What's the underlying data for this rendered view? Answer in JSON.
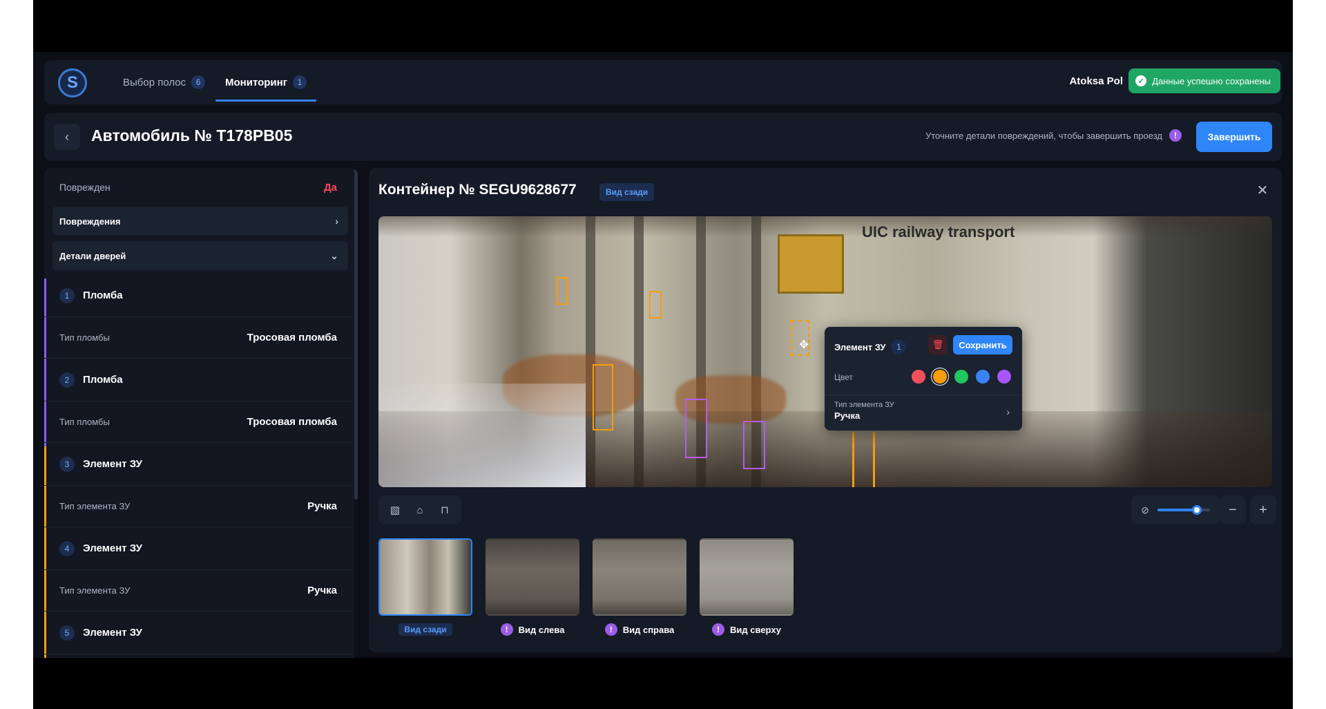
{
  "nav": {
    "tabs": [
      {
        "label": "Выбор полос",
        "count": "6"
      },
      {
        "label": "Мониторинг",
        "count": "1"
      }
    ],
    "user": "Atoksa Pol",
    "toast": "Данные успешно сохранены"
  },
  "header": {
    "title": "Автомобиль № Т178РВ05",
    "hint": "Уточните детали повреждений, чтобы завершить проезд",
    "hint_icon": "!",
    "finish": "Завершить"
  },
  "sidebar": {
    "damaged_label": "Поврежден",
    "damaged_value": "Да",
    "damages_label": "Повреждения",
    "door_details_label": "Детали дверей",
    "items": [
      {
        "num": "1",
        "title": "Пломба",
        "prop_label": "Тип пломбы",
        "prop_value": "Тросовая пломба"
      },
      {
        "num": "2",
        "title": "Пломба",
        "prop_label": "Тип пломбы",
        "prop_value": "Тросовая пломба"
      },
      {
        "num": "3",
        "title": "Элемент ЗУ",
        "prop_label": "Тип элемента ЗУ",
        "prop_value": "Ручка"
      },
      {
        "num": "4",
        "title": "Элемент ЗУ",
        "prop_label": "Тип элемента ЗУ",
        "prop_value": "Ручка"
      },
      {
        "num": "5",
        "title": "Элемент ЗУ"
      }
    ]
  },
  "main": {
    "title": "Контейнер № SEGU9628677",
    "view_badge": "Вид сзади",
    "photo_text": "UIC railway transport",
    "popup": {
      "title": "Элемент ЗУ",
      "count": "1",
      "save": "Сохранить",
      "color_label": "Цвет",
      "colors": [
        "#f0505a",
        "#f59e0b",
        "#22c55e",
        "#3b82f6",
        "#a855f7"
      ],
      "selected_color": "#f59e0b",
      "type_label": "Тип элемента ЗУ",
      "type_value": "Ручка"
    },
    "zoom_level": 0.75,
    "thumbnails": [
      {
        "label": "Вид сзади",
        "warning": false,
        "active": true
      },
      {
        "label": "Вид слева",
        "warning": true,
        "active": false
      },
      {
        "label": "Вид справа",
        "warning": true,
        "active": false
      },
      {
        "label": "Вид сверху",
        "warning": true,
        "active": false
      }
    ]
  },
  "icons": {
    "logo": "logo-icon",
    "back": "chevron-left-icon",
    "close": "close-icon",
    "trash": "trash-icon",
    "move": "move-icon",
    "tools": [
      "crop-icon",
      "tag-icon",
      "lock-icon"
    ],
    "zoom": "zoom-icon",
    "minus": "minus-icon",
    "plus": "plus-icon"
  }
}
